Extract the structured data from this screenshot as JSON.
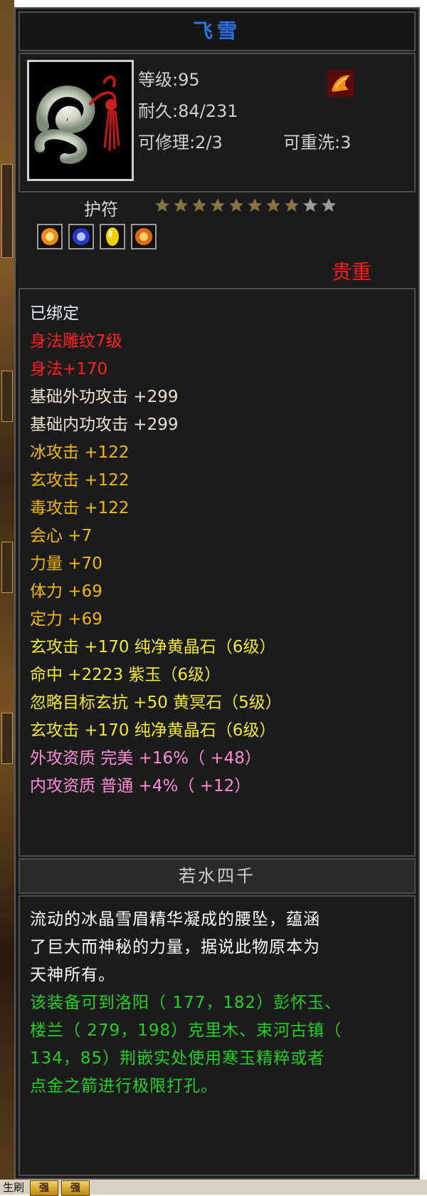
{
  "item": {
    "title": "飞雪",
    "level": "等级:95",
    "durability": "耐久:84/231",
    "repairable": "可修理:2/3",
    "rewash": "可重洗:3",
    "type": "护符",
    "stars": {
      "filled": 8,
      "total": 10
    },
    "rarity": "贵重",
    "name_plate": "若水四千"
  },
  "attributes": [
    {
      "text": "已绑定",
      "color": "#dcecff"
    },
    {
      "text": "身法雕纹7级",
      "color": "#ff2020"
    },
    {
      "text": "身法+170",
      "color": "#ff2020"
    },
    {
      "text": "基础外功攻击  +299",
      "color": "#e8e3d0"
    },
    {
      "text": "基础内功攻击  +299",
      "color": "#e8e3d0"
    },
    {
      "text": "冰攻击  +122",
      "color": "#f0b800"
    },
    {
      "text": "玄攻击  +122",
      "color": "#f0b800"
    },
    {
      "text": "毒攻击  +122",
      "color": "#f0b800"
    },
    {
      "text": "会心  +7",
      "color": "#f0b800"
    },
    {
      "text": "力量  +70",
      "color": "#f0b800"
    },
    {
      "text": "体力  +69",
      "color": "#f0b800"
    },
    {
      "text": "定力  +69",
      "color": "#f0b800"
    },
    {
      "text": "玄攻击  +170  纯净黄晶石（6级）",
      "color": "#f2e830"
    },
    {
      "text": "命中  +2223  紫玉（6级）",
      "color": "#f2e830"
    },
    {
      "text": "忽略目标玄抗  +50  黄冥石（5级）",
      "color": "#f2e830"
    },
    {
      "text": "玄攻击  +170  纯净黄晶石（6级）",
      "color": "#f2e830"
    },
    {
      "text": "外攻资质   完美  +16%（ +48）",
      "color": "#ff8cd8"
    },
    {
      "text": "内攻资质   普通  +4%（ +12）",
      "color": "#ff8cd8"
    }
  ],
  "description": [
    {
      "text": "流动的冰晶雪眉精华凝成的腰坠，蕴涵",
      "color": "#ffffff"
    },
    {
      "text": "了巨大而神秘的力量，据说此物原本为",
      "color": "#ffffff"
    },
    {
      "text": "天神所有。",
      "color": "#ffffff"
    },
    {
      "text": "该装备可到洛阳（ 177，182）彭怀玉、",
      "color": "#22d022"
    },
    {
      "text": "楼兰（ 279，198）克里木、束河古镇（",
      "color": "#22d022"
    },
    {
      "text": "134，85）荆嵌实处使用寒玉精粹或者",
      "color": "#22d022"
    },
    {
      "text": "点金之箭进行极限打孔。",
      "color": "#22d022"
    }
  ],
  "bottom_bar": {
    "label": "生刷",
    "btn1": "强",
    "btn2": "强"
  },
  "colors": {
    "title": "#2c6fe0",
    "rarity": "#ff1a1a",
    "star_filled": "#8a7340",
    "star_empty": "#9a9a9a"
  },
  "icons": {
    "portrait": "jade-pendant-icon",
    "set": "phoenix-feather-icon",
    "gems": [
      "orange-gem-icon",
      "blue-gem-icon",
      "yellow-gem-icon",
      "orange-gem-icon"
    ]
  }
}
